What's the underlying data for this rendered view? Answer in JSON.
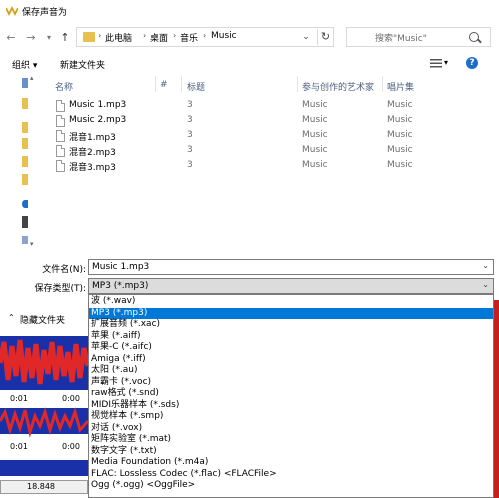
{
  "window": {
    "title": "保存声音为"
  },
  "address": {
    "segments": [
      "此电脑",
      "桌面",
      "音乐",
      "Music"
    ],
    "separator": "›",
    "search_placeholder": "搜索\"Music\""
  },
  "toolbar": {
    "organize": "组织 ▾",
    "new_folder": "新建文件夹"
  },
  "columns": {
    "name": "名称",
    "number": "#",
    "title": "标题",
    "artist": "参与创作的艺术家",
    "album": "唱片集"
  },
  "files": [
    {
      "name": "Music 1.mp3",
      "number": "",
      "title": "3",
      "artist": "Music",
      "album": "Music"
    },
    {
      "name": "Music 2.mp3",
      "number": "",
      "title": "3",
      "artist": "Music",
      "album": "Music"
    },
    {
      "name": "混音1.mp3",
      "number": "",
      "title": "3",
      "artist": "Music",
      "album": "Music"
    },
    {
      "name": "混音2.mp3",
      "number": "",
      "title": "3",
      "artist": "Music",
      "album": "Music"
    },
    {
      "name": "混音3.mp3",
      "number": "",
      "title": "3",
      "artist": "Music",
      "album": "Music"
    }
  ],
  "form": {
    "filename_label": "文件名(N):",
    "filename_value": "Music 1.mp3",
    "filetype_label": "保存类型(T):",
    "filetype_value": "MP3 (*.mp3)"
  },
  "hide_folders": "隐藏文件夹",
  "background": {
    "time1": "0:01",
    "time2": "0:00",
    "time3": "0:01",
    "time4": "0:00",
    "value": "18.848"
  },
  "dropdown_options": [
    "波 (*.wav)",
    "MP3 (*.mp3)",
    "扩展音频 (*.xac)",
    "苹果 (*.aiff)",
    "苹果-C (*.aifc)",
    "Amiga (*.iff)",
    "太阳 (*.au)",
    "声霸卡 (*.voc)",
    "raw格式 (*.snd)",
    "MIDI乐器样本 (*.sds)",
    "视觉样本 (*.smp)",
    "对话 (*.vox)",
    "矩阵实验室 (*.mat)",
    "数字文字 (*.txt)",
    "Media Foundation (*.m4a)",
    "FLAC: Lossless Codec (*.flac)   <FLACFile>",
    "Ogg (*.ogg)    <OggFile>"
  ],
  "selected_index": 1,
  "colors": {
    "accent": "#0078d7",
    "waveform_red": "#c42020",
    "waveform_blue": "#1a30a8"
  }
}
